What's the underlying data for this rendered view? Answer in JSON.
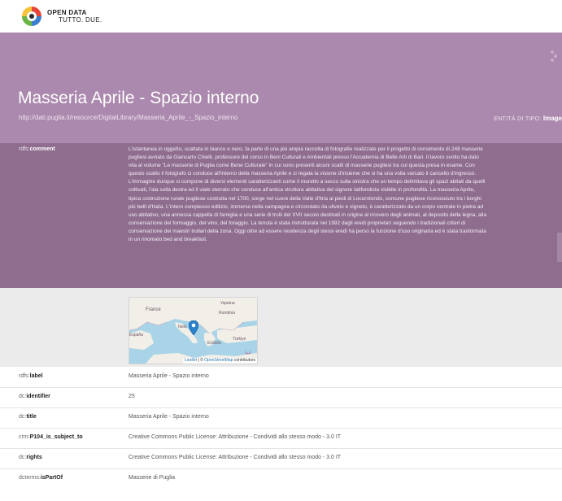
{
  "brand": {
    "line1": "OPEN DATA",
    "line2": "TUTTO. DUE.",
    "colors": {
      "yellow": "#f6c238",
      "green": "#6bb544",
      "red": "#e6463a",
      "blue": "#3a7fd0"
    }
  },
  "header": {
    "title": "Masseria Aprile - Spazio interno",
    "uri": "http://dati.puglia.it/resource/DigitalLibrary/Masseria_Aprile_-_Spazio_interno",
    "entity_label": "ENTITÀ DI TIPO:",
    "entity_type": "Image",
    "bg_color": "#ab88ad"
  },
  "comment": {
    "key_prefix": "rdfs:",
    "key_name": "comment",
    "text": "L'istantanea in oggetto, scattata in bianco e nero, fa parte di una più ampia raccolta di fotografie realizzate per il progetto di censimento di 248 masserie pugliesi avviato da Giancarlo Chielli, professore del corso in Beni Culturali e Ambientali presso l'Accademia di Belle Arti di Bari. Il lavoro svolto ha dato vita al volume \"Le masserie di Puglia come Bene Culturale\" in cui sono presenti alcuni scatti di masserie pugliesi tra cui questa presa in esame. Con questo scatto il fotografo ci conduce all'interno della masseria Aprile e ci regala la visione d'insieme che si ha una volta varcato il cancello d'ingresso. L'immagine dunque si compone di diversi elementi caratterizzanti come il muretto a secco sulla sinistra che un tempo delimitava gli spazi abitati da quelli coltivati, l'aia sulla destra ed il viale sterrato che conduce all'antica struttura abitativa del signore latifondista visibile in profondità. La masseria Aprile, tipica costruzione rurale pugliese costruita nel 1700, sorge nel cuore della Valle d'Itria ai piedi di Locorotondo, comune pugliese riconosciuto tra i borghi più belli d'Italia. L'intero complesso edilizio, immerso nella campagna e circondato da uliveto e vigneto, è caratterizzato da un corpo centrale in pietra ad uso abitativo, una annessa cappella di famiglia e una serie di trulli del XVII secolo destinati in origine al ricovero degli animali, al deposito della legna, alla conservazione del formaggio, del vino, del foraggio. La tenuta è stata ristrutturata nel 1992 dagli eredi proprietari seguendo i tradizionali criteri di conservazione dei maestri trullari della zona. Oggi oltre ad essere residenza degli stessi eredi ha perso la funzione d'uso originaria ed è stata trasformata in un rinomato bed and breakfast.",
    "bg_color": "#8e6d8f"
  },
  "map": {
    "labels": [
      "France",
      "Україна",
      "România",
      "Italia",
      "España",
      "Ελλάδα",
      "Türkiye",
      "ليبيا"
    ],
    "attribution_link": "Leaflet",
    "attribution_sep": " | © ",
    "attribution_osm": "OpenStreetMap",
    "attribution_tail": " contributors",
    "marker_color": "#2a81cb"
  },
  "properties": [
    {
      "prefix": "rdfs:",
      "name": "label",
      "value": "Masseria Aprile - Spazio interno"
    },
    {
      "prefix": "dc:",
      "name": "identifier",
      "value": "25"
    },
    {
      "prefix": "dc:",
      "name": "title",
      "value": "Masseria Aprile - Spazio interno"
    },
    {
      "prefix": "crm:",
      "name": "P104_is_subject_to",
      "value": "Creative Commons Public License: Attribuzione - Condividi allo stesso modo - 3.0 IT"
    },
    {
      "prefix": "dc:",
      "name": "rights",
      "value": "Creative Commons Public License: Attribuzione - Condividi allo stesso modo - 3.0 IT"
    },
    {
      "prefix": "dcterms:",
      "name": "isPartOf",
      "value": "Masserie di Puglia"
    }
  ]
}
